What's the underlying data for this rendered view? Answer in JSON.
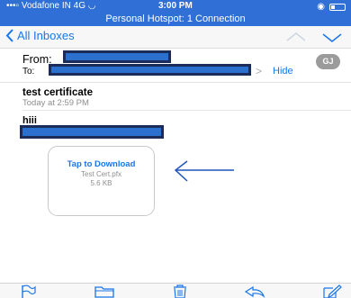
{
  "status_bar": {
    "carrier": "Vodafone IN",
    "network": "4G",
    "time": "3:00 PM",
    "hotspot": "Personal Hotspot: 1 Connection"
  },
  "nav": {
    "back_label": "All Inboxes"
  },
  "header": {
    "from_label": "From:",
    "to_label": "To:",
    "hide_label": "Hide",
    "avatar_initials": "GJ"
  },
  "message": {
    "subject": "test certificate",
    "date": "Today at 2:59 PM",
    "body": "hiii"
  },
  "attachment": {
    "action": "Tap to Download",
    "filename": "Test Cert.pfx",
    "size": "5.6 KB"
  },
  "colors": {
    "accent": "#1a76e8",
    "status_bar": "#2f6fd6",
    "redaction": "#2b70cf",
    "annotation_arrow": "#1f55b8"
  },
  "toolbar": [
    "flag-icon",
    "folder-icon",
    "trash-icon",
    "reply-icon",
    "compose-icon"
  ]
}
